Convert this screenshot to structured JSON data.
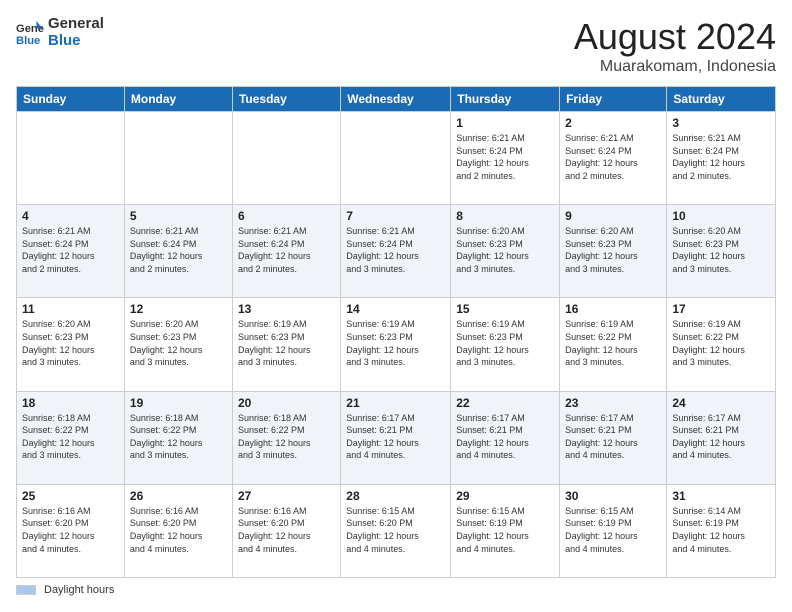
{
  "logo": {
    "line1": "General",
    "line2": "Blue"
  },
  "title": "August 2024",
  "subtitle": "Muarakomam, Indonesia",
  "weekdays": [
    "Sunday",
    "Monday",
    "Tuesday",
    "Wednesday",
    "Thursday",
    "Friday",
    "Saturday"
  ],
  "weeks": [
    [
      {
        "day": "",
        "info": ""
      },
      {
        "day": "",
        "info": ""
      },
      {
        "day": "",
        "info": ""
      },
      {
        "day": "",
        "info": ""
      },
      {
        "day": "1",
        "info": "Sunrise: 6:21 AM\nSunset: 6:24 PM\nDaylight: 12 hours\nand 2 minutes."
      },
      {
        "day": "2",
        "info": "Sunrise: 6:21 AM\nSunset: 6:24 PM\nDaylight: 12 hours\nand 2 minutes."
      },
      {
        "day": "3",
        "info": "Sunrise: 6:21 AM\nSunset: 6:24 PM\nDaylight: 12 hours\nand 2 minutes."
      }
    ],
    [
      {
        "day": "4",
        "info": "Sunrise: 6:21 AM\nSunset: 6:24 PM\nDaylight: 12 hours\nand 2 minutes."
      },
      {
        "day": "5",
        "info": "Sunrise: 6:21 AM\nSunset: 6:24 PM\nDaylight: 12 hours\nand 2 minutes."
      },
      {
        "day": "6",
        "info": "Sunrise: 6:21 AM\nSunset: 6:24 PM\nDaylight: 12 hours\nand 2 minutes."
      },
      {
        "day": "7",
        "info": "Sunrise: 6:21 AM\nSunset: 6:24 PM\nDaylight: 12 hours\nand 3 minutes."
      },
      {
        "day": "8",
        "info": "Sunrise: 6:20 AM\nSunset: 6:23 PM\nDaylight: 12 hours\nand 3 minutes."
      },
      {
        "day": "9",
        "info": "Sunrise: 6:20 AM\nSunset: 6:23 PM\nDaylight: 12 hours\nand 3 minutes."
      },
      {
        "day": "10",
        "info": "Sunrise: 6:20 AM\nSunset: 6:23 PM\nDaylight: 12 hours\nand 3 minutes."
      }
    ],
    [
      {
        "day": "11",
        "info": "Sunrise: 6:20 AM\nSunset: 6:23 PM\nDaylight: 12 hours\nand 3 minutes."
      },
      {
        "day": "12",
        "info": "Sunrise: 6:20 AM\nSunset: 6:23 PM\nDaylight: 12 hours\nand 3 minutes."
      },
      {
        "day": "13",
        "info": "Sunrise: 6:19 AM\nSunset: 6:23 PM\nDaylight: 12 hours\nand 3 minutes."
      },
      {
        "day": "14",
        "info": "Sunrise: 6:19 AM\nSunset: 6:23 PM\nDaylight: 12 hours\nand 3 minutes."
      },
      {
        "day": "15",
        "info": "Sunrise: 6:19 AM\nSunset: 6:23 PM\nDaylight: 12 hours\nand 3 minutes."
      },
      {
        "day": "16",
        "info": "Sunrise: 6:19 AM\nSunset: 6:22 PM\nDaylight: 12 hours\nand 3 minutes."
      },
      {
        "day": "17",
        "info": "Sunrise: 6:19 AM\nSunset: 6:22 PM\nDaylight: 12 hours\nand 3 minutes."
      }
    ],
    [
      {
        "day": "18",
        "info": "Sunrise: 6:18 AM\nSunset: 6:22 PM\nDaylight: 12 hours\nand 3 minutes."
      },
      {
        "day": "19",
        "info": "Sunrise: 6:18 AM\nSunset: 6:22 PM\nDaylight: 12 hours\nand 3 minutes."
      },
      {
        "day": "20",
        "info": "Sunrise: 6:18 AM\nSunset: 6:22 PM\nDaylight: 12 hours\nand 3 minutes."
      },
      {
        "day": "21",
        "info": "Sunrise: 6:17 AM\nSunset: 6:21 PM\nDaylight: 12 hours\nand 4 minutes."
      },
      {
        "day": "22",
        "info": "Sunrise: 6:17 AM\nSunset: 6:21 PM\nDaylight: 12 hours\nand 4 minutes."
      },
      {
        "day": "23",
        "info": "Sunrise: 6:17 AM\nSunset: 6:21 PM\nDaylight: 12 hours\nand 4 minutes."
      },
      {
        "day": "24",
        "info": "Sunrise: 6:17 AM\nSunset: 6:21 PM\nDaylight: 12 hours\nand 4 minutes."
      }
    ],
    [
      {
        "day": "25",
        "info": "Sunrise: 6:16 AM\nSunset: 6:20 PM\nDaylight: 12 hours\nand 4 minutes."
      },
      {
        "day": "26",
        "info": "Sunrise: 6:16 AM\nSunset: 6:20 PM\nDaylight: 12 hours\nand 4 minutes."
      },
      {
        "day": "27",
        "info": "Sunrise: 6:16 AM\nSunset: 6:20 PM\nDaylight: 12 hours\nand 4 minutes."
      },
      {
        "day": "28",
        "info": "Sunrise: 6:15 AM\nSunset: 6:20 PM\nDaylight: 12 hours\nand 4 minutes."
      },
      {
        "day": "29",
        "info": "Sunrise: 6:15 AM\nSunset: 6:19 PM\nDaylight: 12 hours\nand 4 minutes."
      },
      {
        "day": "30",
        "info": "Sunrise: 6:15 AM\nSunset: 6:19 PM\nDaylight: 12 hours\nand 4 minutes."
      },
      {
        "day": "31",
        "info": "Sunrise: 6:14 AM\nSunset: 6:19 PM\nDaylight: 12 hours\nand 4 minutes."
      }
    ]
  ],
  "footer": {
    "legend_label": "Daylight hours"
  }
}
